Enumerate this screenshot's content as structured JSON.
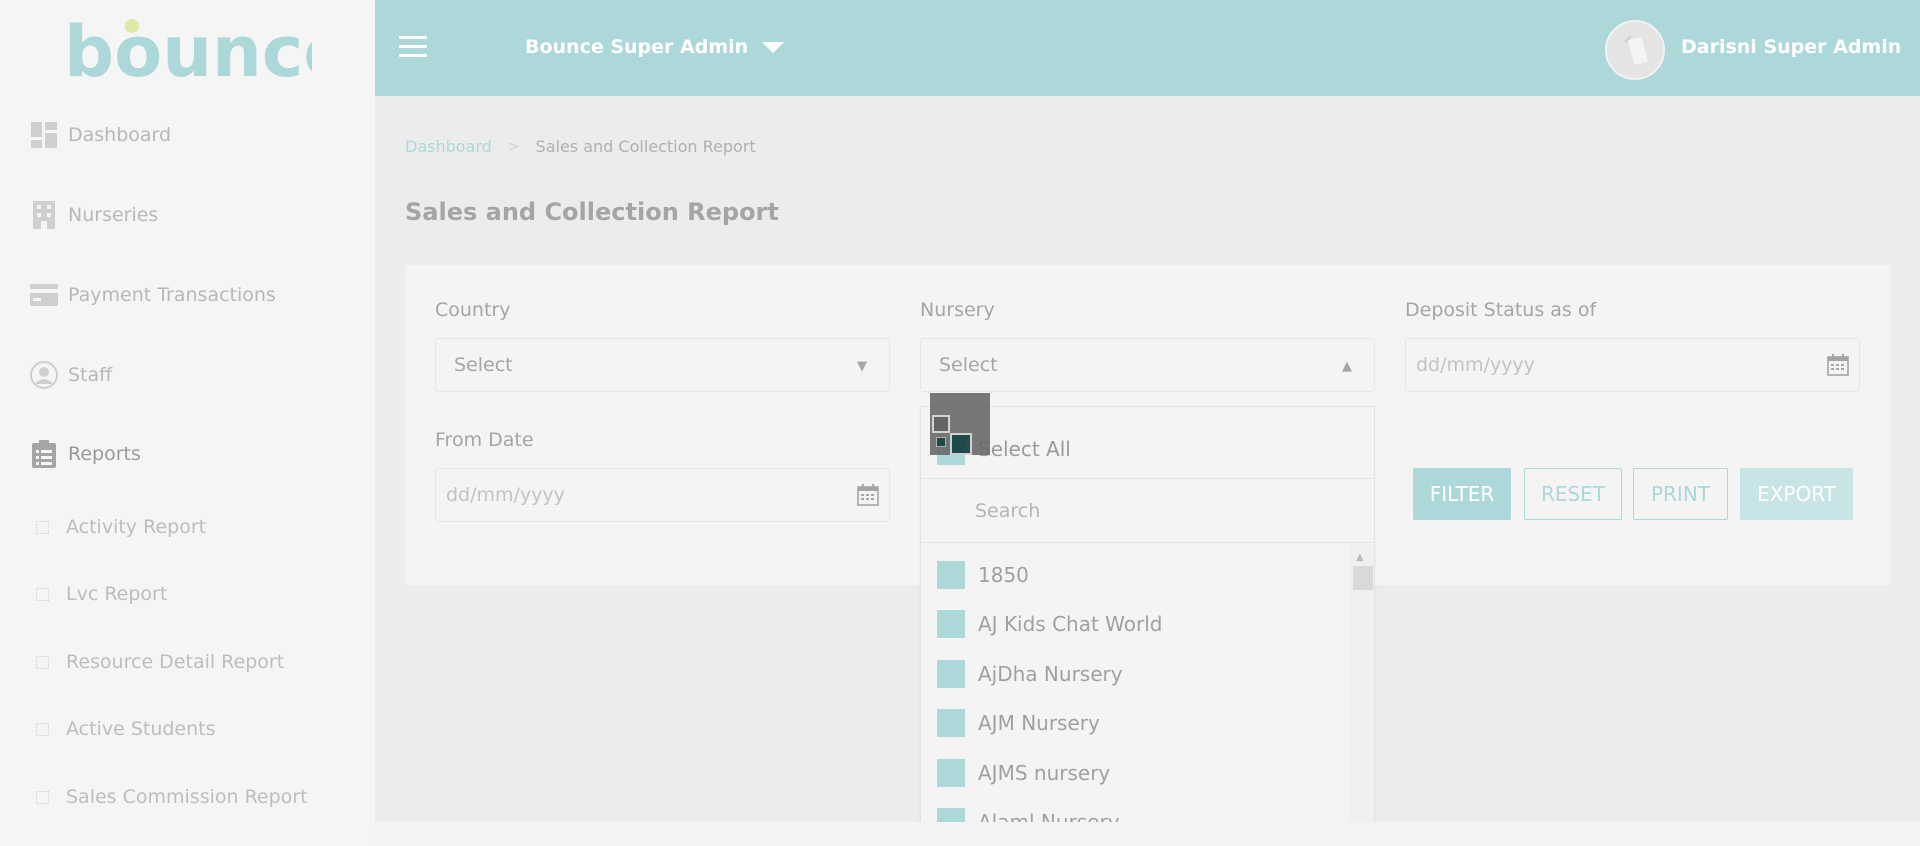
{
  "brand": {
    "name": "bounce",
    "color": "#acd8da",
    "accent_dot": "#dfe8a8"
  },
  "sidebar": {
    "items": [
      {
        "label": "Dashboard",
        "icon": "dashboard-icon"
      },
      {
        "label": "Nurseries",
        "icon": "building-icon"
      },
      {
        "label": "Payment Transactions",
        "icon": "card-icon"
      },
      {
        "label": "Staff",
        "icon": "user-icon"
      },
      {
        "label": "Reports",
        "icon": "clipboard-icon"
      }
    ],
    "sub_items": [
      {
        "label": "Activity Report"
      },
      {
        "label": "Lvc Report"
      },
      {
        "label": "Resource Detail Report"
      },
      {
        "label": "Active Students"
      },
      {
        "label": "Sales Commission Report"
      }
    ]
  },
  "header": {
    "org_name": "Bounce Super Admin",
    "user_name": "Darisni Super Admin"
  },
  "breadcrumb": {
    "home": "Dashboard",
    "separator": ">",
    "current": "Sales and Collection Report"
  },
  "page": {
    "title": "Sales and Collection Report"
  },
  "form": {
    "country": {
      "label": "Country",
      "value": "Select"
    },
    "nursery": {
      "label": "Nursery",
      "value": "Select"
    },
    "deposit_status": {
      "label": "Deposit Status as of",
      "placeholder": "dd/mm/yyyy"
    },
    "from_date": {
      "label": "From Date",
      "placeholder": "dd/mm/yyyy"
    }
  },
  "buttons": {
    "filter": "FILTER",
    "reset": "RESET",
    "print": "PRINT",
    "export": "EXPORT"
  },
  "dropdown": {
    "select_all": "Select All",
    "search_placeholder": "Search",
    "options": [
      "1850",
      "AJ Kids Chat World",
      "AjDha Nursery",
      "AJM Nursery",
      "AJMS nursery",
      "Alaml Nursery"
    ]
  }
}
